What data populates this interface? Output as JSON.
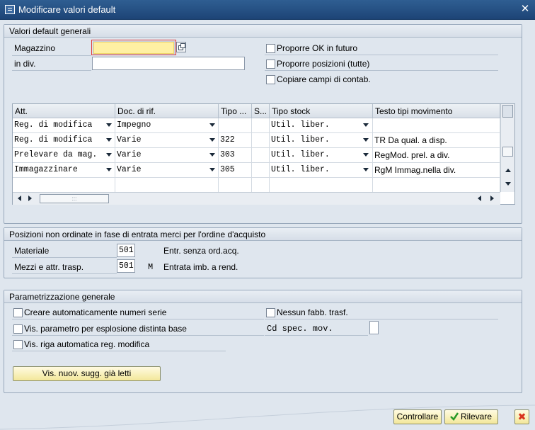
{
  "window": {
    "title": "Modificare valori default",
    "close_glyph": "✕"
  },
  "general_defaults": {
    "header": "Valori default generali",
    "magazzino_label": "Magazzino",
    "magazzino_value": "",
    "in_div_label": "in div.",
    "in_div_value": "",
    "checkboxes": [
      {
        "label": "Proporre OK in futuro",
        "checked": false
      },
      {
        "label": "Proporre posizioni (tutte)",
        "checked": false
      },
      {
        "label": "Copiare campi di contab.",
        "checked": false
      }
    ]
  },
  "movement_table": {
    "columns": [
      "Att.",
      "Doc. di rif.",
      "Tipo ...",
      "S...",
      "Tipo stock",
      "Testo tipi movimento"
    ],
    "rows": [
      {
        "att": "Reg. di modifica",
        "doc": "Impegno",
        "tipo": "",
        "s": "",
        "stock": "Util. liber.",
        "testo": ""
      },
      {
        "att": "Reg. di modifica",
        "doc": "Varie",
        "tipo": "322",
        "s": "",
        "stock": "Util. liber.",
        "testo": "TR Da qual. a disp."
      },
      {
        "att": "Prelevare da mag.",
        "doc": "Varie",
        "tipo": "303",
        "s": "",
        "stock": "Util. liber.",
        "testo": "RegMod. prel. a div."
      },
      {
        "att": "Immagazzinare",
        "doc": "Varie",
        "tipo": "305",
        "s": "",
        "stock": "Util. liber.",
        "testo": "RgM Immag.nella div."
      }
    ],
    "hscroll_grip": ":::"
  },
  "unordered_items": {
    "header": "Posizioni non ordinate in fase di entrata merci per l'ordine d'acquisto",
    "materiale_label": "Materiale",
    "materiale_value": "501",
    "materiale_text": "Entr. senza ord.acq.",
    "mezzi_label": "Mezzi e attr. trasp.",
    "mezzi_value": "501",
    "mezzi_flag": "M",
    "mezzi_text": "Entrata imb. a rend."
  },
  "general_settings": {
    "header": "Parametrizzazione generale",
    "left_checkboxes": [
      {
        "label": "Creare automaticamente numeri serie",
        "checked": false
      },
      {
        "label": "Vis. parametro per esplosione distinta base",
        "checked": false
      },
      {
        "label": "Vis. riga automatica reg. modifica",
        "checked": false
      }
    ],
    "right_checkbox": {
      "label": "Nessun fabb. trasf.",
      "checked": false
    },
    "cd_spec_label": "Cd spec. mov.",
    "cd_spec_value": "",
    "button_label": "Vis. nuov. sugg. già letti"
  },
  "footer": {
    "controllare_label": "Controllare",
    "rilevare_label": "Rilevare",
    "cancel_glyph": "✖"
  },
  "colors": {
    "titlebar": "#1d4476",
    "panel_bg": "#dfe6ee",
    "required_field": "#fff0a3",
    "button_yellow": "#f3e79a",
    "cancel_red": "#d8321e",
    "check_green": "#2a9a2a"
  }
}
